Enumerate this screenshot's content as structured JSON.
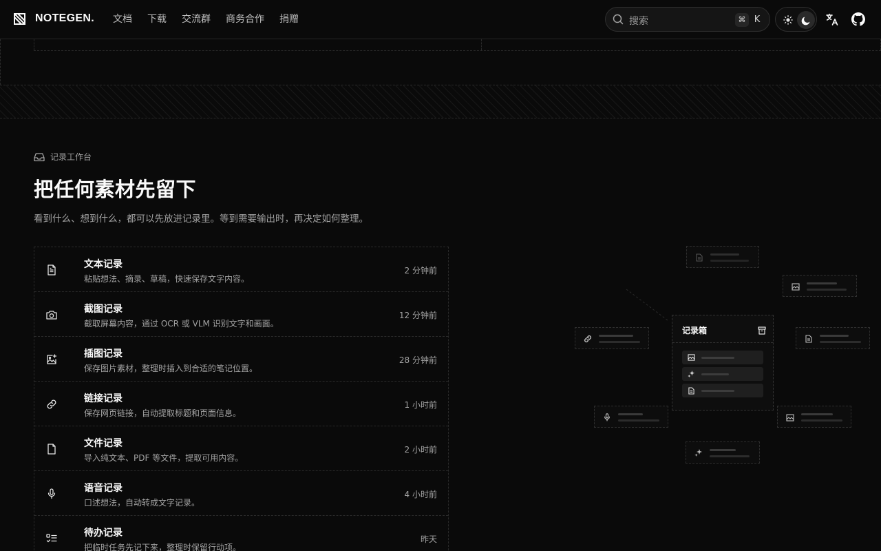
{
  "brand": {
    "name": "NOTEGEN."
  },
  "nav": [
    "文档",
    "下载",
    "交流群",
    "商务合作",
    "捐赠"
  ],
  "search": {
    "label": "搜索",
    "shortcut_mod": "⌘",
    "shortcut_key": "K"
  },
  "section": {
    "eyebrow": "记录工作台",
    "title": "把任何素材先留下",
    "subtitle": "看到什么、想到什么，都可以先放进记录里。等到需要输出时，再决定如何整理。"
  },
  "records": [
    {
      "icon": "text-doc-icon",
      "title": "文本记录",
      "desc": "粘贴想法、摘录、草稿，快速保存文字内容。",
      "time": "2 分钟前"
    },
    {
      "icon": "camera-icon",
      "title": "截图记录",
      "desc": "截取屏幕内容，通过 OCR 或 VLM 识别文字和画面。",
      "time": "12 分钟前"
    },
    {
      "icon": "image-plus-icon",
      "title": "插图记录",
      "desc": "保存图片素材，整理时插入到合适的笔记位置。",
      "time": "28 分钟前"
    },
    {
      "icon": "link-icon",
      "title": "链接记录",
      "desc": "保存网页链接，自动提取标题和页面信息。",
      "time": "1 小时前"
    },
    {
      "icon": "file-icon",
      "title": "文件记录",
      "desc": "导入纯文本、PDF 等文件，提取可用内容。",
      "time": "2 小时前"
    },
    {
      "icon": "mic-icon",
      "title": "语音记录",
      "desc": "口述想法，自动转成文字记录。",
      "time": "4 小时前"
    },
    {
      "icon": "todo-list-icon",
      "title": "待办记录",
      "desc": "把临时任务先记下来，整理时保留行动项。",
      "time": "昨天"
    }
  ],
  "diagram": {
    "inbox_title": "记录箱"
  },
  "colors": {
    "background": "#0a0a0a",
    "text": "#fafafa",
    "muted": "#a3a3a3",
    "border": "#2a2a2a"
  }
}
